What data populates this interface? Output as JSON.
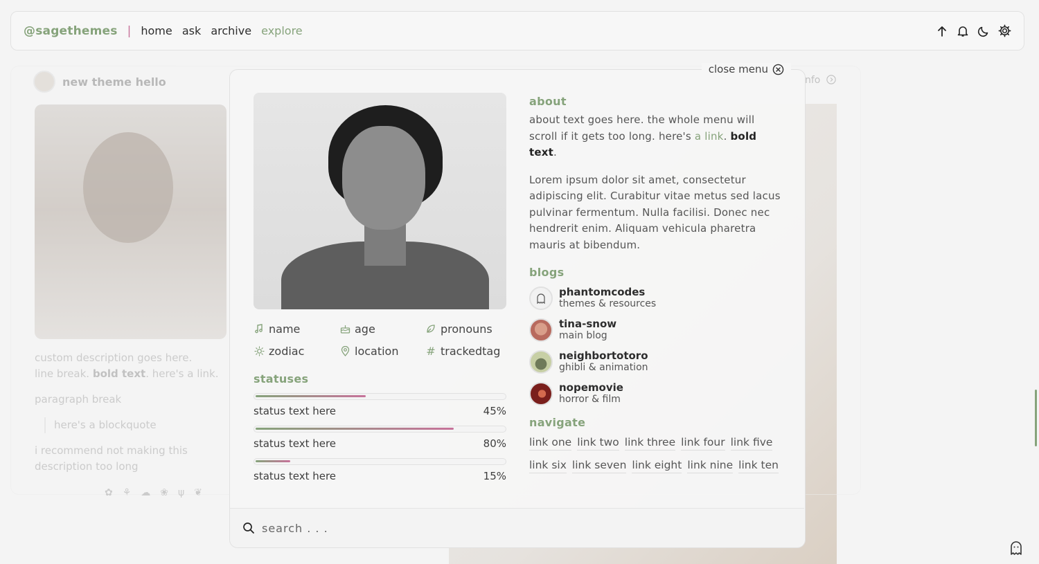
{
  "topbar": {
    "username": "@sagethemes",
    "separator": "|",
    "nav": [
      {
        "label": "home"
      },
      {
        "label": "ask"
      },
      {
        "label": "archive"
      },
      {
        "label": "explore",
        "active": true
      }
    ],
    "icons": [
      "arrow-up-icon",
      "bell-icon",
      "moon-icon",
      "gear-icon"
    ]
  },
  "background_post": {
    "title": "new theme hello",
    "info_label": "nfo",
    "description": {
      "line1": "custom description goes here.",
      "line2_pre": "line break. ",
      "line2_bold": "bold text",
      "line2_link": ". here's a link.",
      "paragraph": "paragraph break",
      "blockquote": "here's a blockquote",
      "note": "i recommend not making this description too long"
    },
    "tag_icons": [
      "flower-icon",
      "tulip-icon",
      "cloud-icon",
      "lotus-icon",
      "cactus-icon",
      "sprout-icon"
    ]
  },
  "menu": {
    "close_label": "close menu",
    "facts": [
      {
        "icon": "music-note-icon",
        "label": "name"
      },
      {
        "icon": "cake-icon",
        "label": "age"
      },
      {
        "icon": "leaf-icon",
        "label": "pronouns"
      },
      {
        "icon": "sun-icon",
        "label": "zodiac"
      },
      {
        "icon": "location-pin-icon",
        "label": "location"
      },
      {
        "icon": "hashtag-icon",
        "label": "trackedtag"
      }
    ],
    "statuses_heading": "statuses",
    "statuses": [
      {
        "label": "status text here",
        "percent_label": "45%",
        "value": 45
      },
      {
        "label": "status text here",
        "percent_label": "80%",
        "value": 80
      },
      {
        "label": "status text here",
        "percent_label": "15%",
        "value": 15
      }
    ],
    "about_heading": "about",
    "about": {
      "pre": "about text goes here. the whole menu will scroll if it gets too long. here's ",
      "link": "a link",
      "mid": ". ",
      "bold": "bold text",
      "post": "."
    },
    "lorem": "Lorem ipsum dolor sit amet, consectetur adipiscing elit. Curabitur vitae metus sed lacus pulvinar fermentum. Nulla facilisi. Donec nec hendrerit enim. Aliquam vehicula pharetra mauris at bibendum.",
    "blogs_heading": "blogs",
    "blogs": [
      {
        "name": "phantomcodes",
        "desc": "themes & resources",
        "color": "#f2f2f2"
      },
      {
        "name": "tina-snow",
        "desc": "main blog",
        "color": "#b86a5e"
      },
      {
        "name": "neighbortotoro",
        "desc": "ghibli & animation",
        "color": "#a9b28a"
      },
      {
        "name": "nopemovie",
        "desc": "horror & film",
        "color": "#7a1f1c"
      }
    ],
    "navigate_heading": "navigate",
    "links": [
      "link one",
      "link two",
      "link three",
      "link four",
      "link five",
      "link six",
      "link seven",
      "link eight",
      "link nine",
      "link ten"
    ],
    "search_placeholder": "search . . ."
  },
  "colors": {
    "accent_green": "#86a37b",
    "accent_pink": "#c7729a"
  }
}
